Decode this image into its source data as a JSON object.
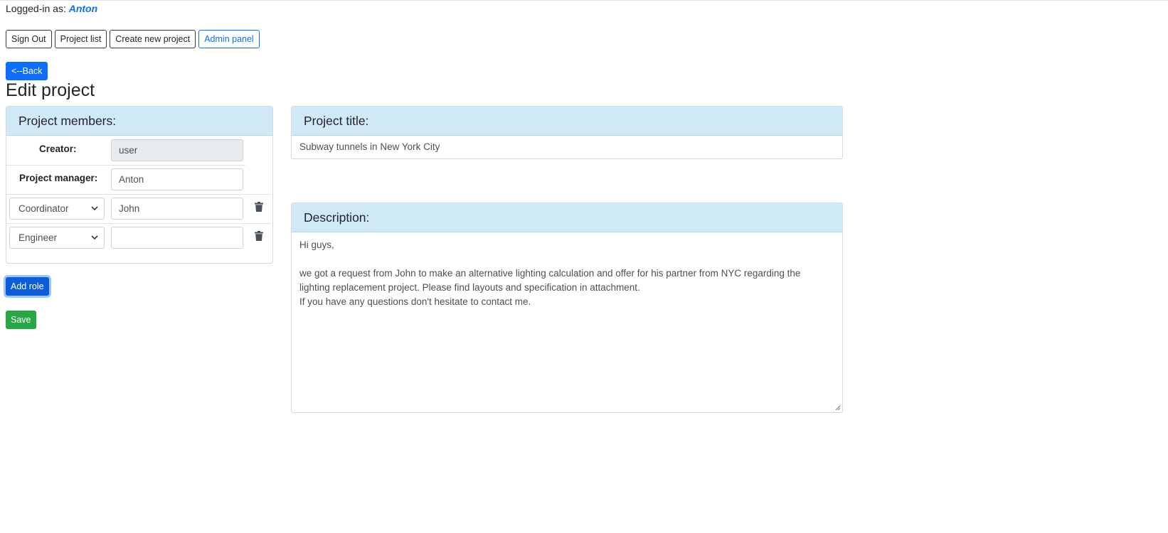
{
  "header": {
    "logged_label": "Logged-in as:",
    "user_name": "Anton"
  },
  "nav": {
    "sign_out": "Sign Out",
    "project_list": "Project list",
    "create_project": "Create new project",
    "admin_panel": "Admin panel"
  },
  "back_label": "<--Back",
  "page_title": "Edit project",
  "members": {
    "header": "Project members:",
    "creator_label": "Creator:",
    "creator_value": "user",
    "manager_label": "Project manager:",
    "manager_value": "Anton",
    "roles": [
      {
        "role": "Coordinator",
        "name": "John"
      },
      {
        "role": "Engineer",
        "name": ""
      }
    ]
  },
  "add_role_label": "Add role",
  "save_label": "Save",
  "project_title": {
    "header": "Project title:",
    "value": "Subway tunnels in New York City"
  },
  "description": {
    "header": "Description:",
    "line1": "Hi guys,",
    "line2": "we got a request from John to make an alternative lighting calculation and offer for his partner from NYC regarding the",
    "line3": "lighting replacement project. Please find layouts and specification in attachment.",
    "line4": "If you have any questions don't hesitate to contact me."
  },
  "colors": {
    "primary": "#0d6efd",
    "success": "#28a745",
    "card_header": "#cfe9f7"
  }
}
